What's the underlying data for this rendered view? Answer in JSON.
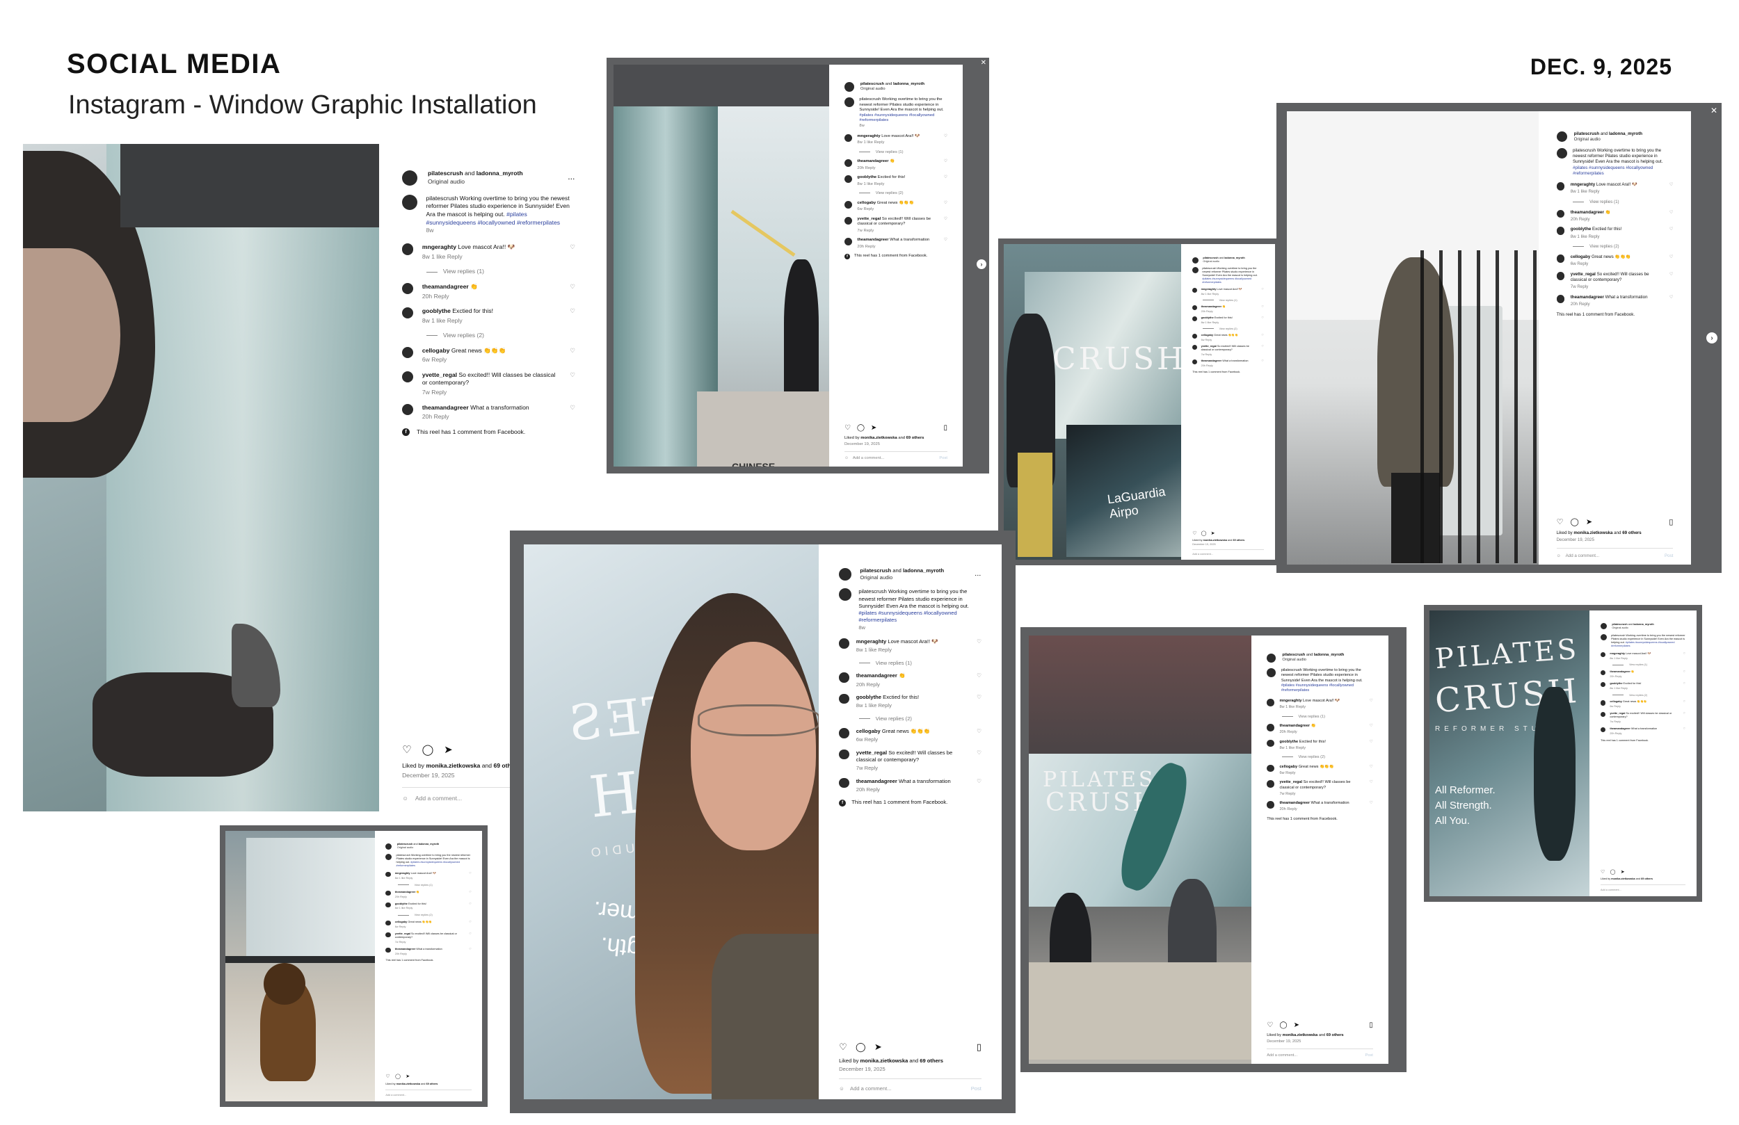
{
  "header": {
    "title": "SOCIAL MEDIA",
    "subtitle": "Instagram - Window Graphic Installation",
    "date": "DEC. 9, 2025"
  },
  "post": {
    "user1": "pilatescrush",
    "and": "and",
    "user2": "ladonna_myroth",
    "audio": "Original audio",
    "more": "...",
    "caption_text": "pilatescrush Working overtime to bring you the newest reformer Pilates studio experience in Sunnyside! Even Ara the mascot is helping out.",
    "caption_tags": "#pilates #sunnysidequeens #locallyowned #reformerpilates",
    "caption_age": "8w",
    "comments": [
      {
        "user": "mngeraghty",
        "text": "Love mascot Ara!! 🐶",
        "age": "8w",
        "likes": "1 like",
        "reply": "Reply",
        "view_replies": "View replies (1)"
      },
      {
        "user": "theamandagreer",
        "text": "👏",
        "age": "20h",
        "likes": "",
        "reply": "Reply",
        "view_replies": ""
      },
      {
        "user": "gooblythe",
        "text": "Exctied for this!",
        "age": "8w",
        "likes": "1 like",
        "reply": "Reply",
        "view_replies": "View replies (2)"
      },
      {
        "user": "cellogaby",
        "text": "Great news 👏👏👏",
        "age": "6w",
        "likes": "",
        "reply": "Reply",
        "view_replies": ""
      },
      {
        "user": "yvette_regal",
        "text": "So excited!! Will classes be classical or contemporary?",
        "age": "7w",
        "likes": "",
        "reply": "Reply",
        "view_replies": ""
      },
      {
        "user": "theamandagreer",
        "text": "What a transformation",
        "age": "20h",
        "likes": "",
        "reply": "Reply",
        "view_replies": ""
      }
    ],
    "facebook_note": "This reel has 1 comment from Facebook.",
    "liked_by_prefix": "Liked by",
    "liked_by_user": "monika.zietkowska",
    "liked_by_and": "and",
    "liked_by_others": "69 others",
    "date": "December 19, 2025",
    "add_comment": "Add a comment...",
    "post_label": "Post",
    "icons": [
      "heart-icon",
      "comment-icon",
      "share-icon",
      "bookmark-icon",
      "emoji-icon",
      "facebook-icon",
      "close-icon",
      "next-arrow-icon"
    ]
  },
  "window_graphic": {
    "brand": "PILATES",
    "brand2": "CRUSH",
    "studio": "REFORMER STUDIO",
    "mirror_text_1": "former.",
    "mirror_text_2": "ngth.",
    "tagline": [
      "All Reformer.",
      "All Strength.",
      "All You."
    ],
    "airport_sign": "LaGuardia Airpo",
    "store_sign": "CHINESE"
  },
  "colors": {
    "frame": "#5e5f61",
    "tag": "#2a3f9d",
    "panel": "#ffffff"
  }
}
